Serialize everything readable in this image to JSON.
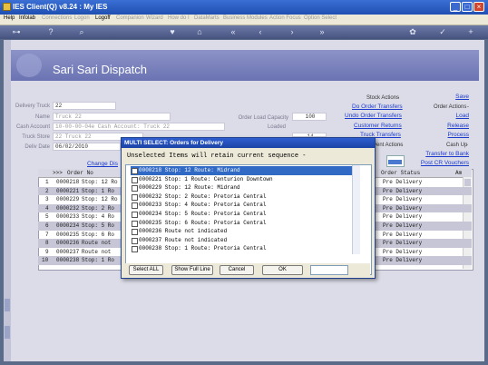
{
  "window": {
    "title": "IES Client(Q) v8.24 : My IES"
  },
  "menu": [
    {
      "label": "Help",
      "enabled": true
    },
    {
      "label": "Infolab",
      "enabled": true
    },
    {
      "label": "Connections",
      "enabled": false
    },
    {
      "label": "Logon",
      "enabled": false
    },
    {
      "label": "Logoff",
      "enabled": true
    },
    {
      "label": "Companion",
      "enabled": false
    },
    {
      "label": "Wizard",
      "enabled": false
    },
    {
      "label": "How do I",
      "enabled": false
    },
    {
      "label": "DataMarts",
      "enabled": false
    },
    {
      "label": "Business Modules",
      "enabled": false
    },
    {
      "label": "Action Focus",
      "enabled": false
    },
    {
      "label": "Option Select",
      "enabled": false
    }
  ],
  "header": {
    "title": "Sari Sari Dispatch"
  },
  "form": {
    "delivery_truck_label": "Delivery Truck",
    "delivery_truck": "22",
    "name_label": "Name",
    "name": "Truck 22",
    "cash_account_label": "Cash Account",
    "cash_account": "10-00-00-04e Cash Account: Truck 22",
    "truck_store_label": "Truck Store",
    "truck_store": "22 Truck 22",
    "deliv_date_label": "Deliv Date",
    "deliv_date": "06/02/2010",
    "load_capacity_label": "Order Load Capacity",
    "load_capacity": "100",
    "loaded_label": "Loaded",
    "loaded": "14",
    "change_link": "Change Dis"
  },
  "stock_actions": {
    "label": "Stock Actions",
    "links": [
      "Do Order Transfers",
      "Undo Order Transfers",
      "Customer Returns",
      "Truck Transfers"
    ]
  },
  "order_actions": {
    "label": "Order Actions",
    "save": "Save",
    "links": [
      "Load",
      "Release",
      "Process"
    ]
  },
  "event_actions": {
    "label": "vent Actions"
  },
  "cash_up": {
    "label": "Cash Up",
    "links": [
      "Transfer to Bank",
      "Post CR Vouchers"
    ]
  },
  "grid": {
    "columns": [
      ">>>",
      "Order No",
      "Order Status",
      "Am"
    ],
    "rows": [
      {
        "n": "1",
        "order": "0000218",
        "desc": "Stop: 12 Ro",
        "status": "Pre Delivery"
      },
      {
        "n": "2",
        "order": "0000221",
        "desc": "Stop: 1 Ro",
        "status": "Pre Delivery"
      },
      {
        "n": "3",
        "order": "0000229",
        "desc": "Stop: 12 Ro",
        "status": "Pre Delivery"
      },
      {
        "n": "4",
        "order": "0000232",
        "desc": "Stop: 2 Ro",
        "status": "Pre Delivery"
      },
      {
        "n": "5",
        "order": "0000233",
        "desc": "Stop: 4 Ro",
        "status": "Pre Delivery"
      },
      {
        "n": "6",
        "order": "0000234",
        "desc": "Stop: 5 Ro",
        "status": "Pre Delivery"
      },
      {
        "n": "7",
        "order": "0000235",
        "desc": "Stop: 6 Ro",
        "status": "Pre Delivery"
      },
      {
        "n": "8",
        "order": "0000236",
        "desc": "Route not",
        "status": "Pre Delivery"
      },
      {
        "n": "9",
        "order": "0000237",
        "desc": "Route not",
        "status": "Pre Delivery"
      },
      {
        "n": "10",
        "order": "0000238",
        "desc": "Stop: 1 Ro",
        "status": "Pre Delivery"
      }
    ]
  },
  "modal": {
    "title": "MULTI SELECT: Orders for Delivery",
    "subtitle": "Unselected Items will retain current sequence -",
    "items": [
      "0000218 Stop: 12 Route: Midrand",
      "0000221 Stop: 1 Route: Centurion Downtown",
      "0000229 Stop: 12 Route: Midrand",
      "0000232 Stop: 2 Route: Pretoria Central",
      "0000233 Stop: 4 Route: Pretoria Central",
      "0000234 Stop: 5 Route: Pretoria Central",
      "0000235 Stop: 6 Route: Pretoria Central",
      "0000236 Route not indicated",
      "0000237 Route not indicated",
      "0000238 Stop: 1 Route: Pretoria Central"
    ],
    "buttons": {
      "select_all": "Select ALL",
      "show_full": "Show Full Line",
      "cancel": "Cancel",
      "ok": "OK"
    }
  },
  "colors": {
    "title_bar": "#1f4fb3",
    "header_band": "#6b73b3",
    "selection": "#316ac5"
  }
}
